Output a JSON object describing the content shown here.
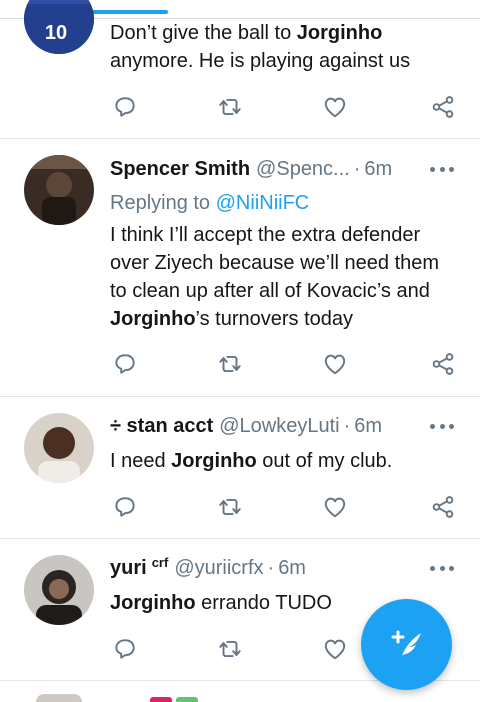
{
  "tweets": [
    {
      "text_lines": [
        [
          {
            "t": "Don’t give the ball to ",
            "b": false
          },
          {
            "t": "Jorginho",
            "b": true
          }
        ],
        [
          {
            "t": "anymore. He is playing against us",
            "b": false
          }
        ]
      ],
      "jersey_number": "10"
    },
    {
      "name": "Spencer Smith",
      "handle": "@Spenc...",
      "dot": "·",
      "time": "6m",
      "replying_label": "Replying to",
      "replying_handle": "@NiiNiiFC",
      "text_lines": [
        [
          {
            "t": "I think I’ll accept the extra defender",
            "b": false
          }
        ],
        [
          {
            "t": "over Ziyech because we’ll need them",
            "b": false
          }
        ],
        [
          {
            "t": "to clean up after all of Kovacic’s and",
            "b": false
          }
        ],
        [
          {
            "t": "Jorginho",
            "b": true
          },
          {
            "t": "’s turnovers today",
            "b": false
          }
        ]
      ]
    },
    {
      "name": "÷ stan acct",
      "handle": "@LowkeyLuti",
      "dot": "·",
      "time": "6m",
      "text_lines": [
        [
          {
            "t": "I need ",
            "b": false
          },
          {
            "t": "Jorginho",
            "b": true
          },
          {
            "t": " out of my club.",
            "b": false
          }
        ]
      ]
    },
    {
      "name": "yuri",
      "name_sup": "crf",
      "handle": "@yuriicrfx",
      "dot": "·",
      "time": "6m",
      "text_lines": [
        [
          {
            "t": "Jorginho",
            "b": true
          },
          {
            "t": " errando TUDO",
            "b": false
          }
        ]
      ]
    }
  ],
  "colors": {
    "accent": "#1da1f2",
    "text": "#14171a",
    "muted": "#657786",
    "divider": "#e1e8ed"
  },
  "icons": {
    "reply": "reply-icon",
    "retweet": "retweet-icon",
    "like": "heart-icon",
    "share": "share-icon",
    "compose": "compose-tweet-icon",
    "more": "more-dots-icon"
  }
}
